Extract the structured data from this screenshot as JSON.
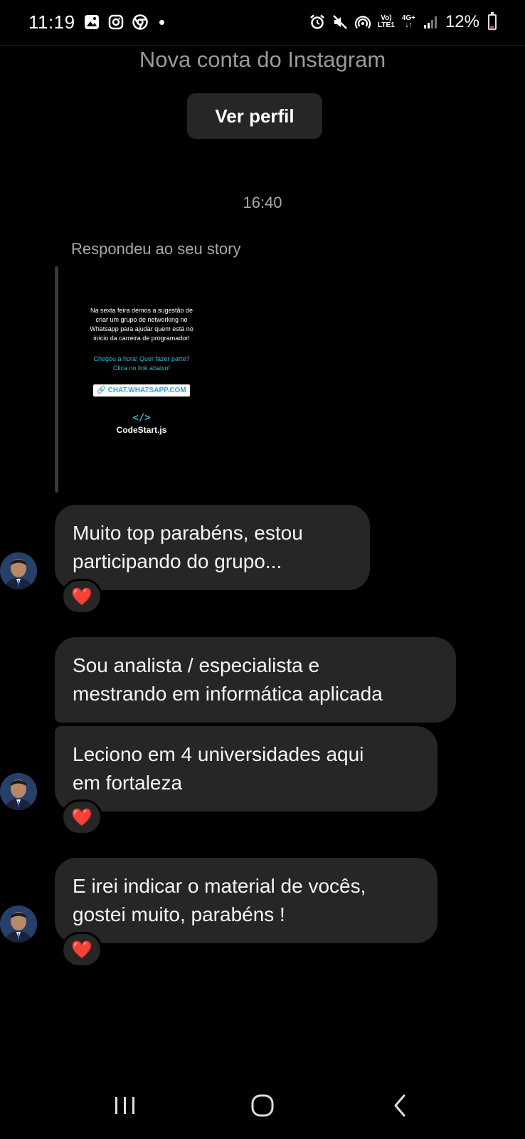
{
  "status_bar": {
    "time": "11:19",
    "left_icons": [
      "gallery-icon",
      "instagram-icon",
      "chrome-icon"
    ],
    "right_icons": [
      "alarm-icon",
      "mute-icon",
      "hotspot-icon",
      "volte-icon",
      "4g-icon",
      "signal-icon"
    ],
    "volte_label_top": "Vo)",
    "volte_label_bottom": "LTE1",
    "network_label_top": "4G+",
    "network_label_bottom": "↓↑",
    "battery_percent": "12%",
    "battery_level": 0.12
  },
  "header": {
    "account_label": "Nova conta do Instagram",
    "view_profile_button": "Ver perfil"
  },
  "conversation": {
    "timestamp": "16:40",
    "story_reply_label": "Respondeu ao seu story",
    "story": {
      "text": "Na sexta feira demos a sugestão de criar um grupo de networking no Whatsapp para ajudar quem está no início da carreira de programador!",
      "cta": "Chegou a hora! Quer fazer parte? Clica no link abaixo!",
      "link": "CHAT.WHATSAPP.COM",
      "brand_icon": "</>",
      "brand": "CodeStart.js"
    },
    "messages": [
      {
        "text_line1": "Muito top parabéns, estou",
        "text_line2": "participando do grupo...",
        "reaction": "❤️"
      },
      {
        "text_line1": "Sou analista / especialista e",
        "text_line2": "mestrando em informática aplicada"
      },
      {
        "text_line1": "Leciono em 4 universidades aqui",
        "text_line2": "em fortaleza",
        "reaction": "❤️"
      },
      {
        "text_line1": "E irei indicar o material de vocês,",
        "text_line2": "gostei muito, parabéns !",
        "reaction": "❤️"
      }
    ]
  },
  "nav_bar": {
    "icons": [
      "recent-apps-icon",
      "home-icon",
      "back-icon"
    ]
  },
  "colors": {
    "background": "#000000",
    "bubble": "#262626",
    "muted_text": "#a8a8a8",
    "heart": "#ff2d3d",
    "accent": "#33b8d4"
  }
}
